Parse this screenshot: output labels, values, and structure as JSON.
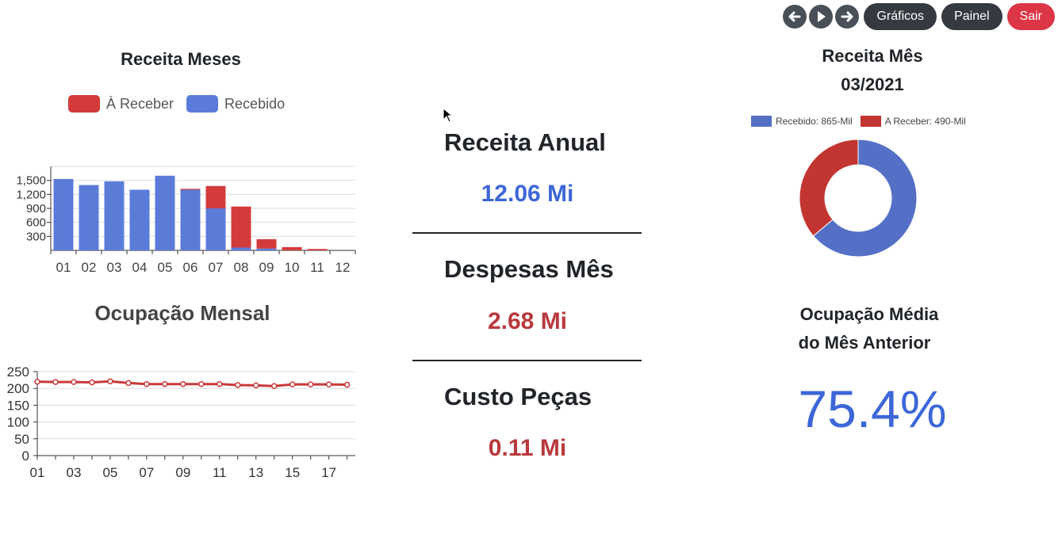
{
  "nav": {
    "graficos_label": "Gráficos",
    "painel_label": "Painel",
    "sair_label": "Sair",
    "prev_icon": "arrow-left-icon",
    "play_icon": "play-icon",
    "next_icon": "arrow-right-icon"
  },
  "kpis": {
    "receita_anual": {
      "title": "Receita Anual",
      "value": "12.06 Mi"
    },
    "despesas_mes": {
      "title": "Despesas Mês",
      "value": "2.68 Mi"
    },
    "custo_pecas": {
      "title": "Custo Peças",
      "value": "0.11 Mi"
    }
  },
  "ocupacao_media": {
    "title_line1": "Ocupação Média",
    "title_line2": "do Mês Anterior",
    "value": "75.4%"
  },
  "colors": {
    "blue": "#5b7bd9",
    "red": "#d33b3b",
    "pill_dark": "#343a40",
    "pill_red": "#dc3545",
    "value_blue": "#3d67d8",
    "value_red": "#b8393d"
  },
  "chart_data": [
    {
      "type": "bar",
      "stacked": true,
      "title": "Receita Meses",
      "categories": [
        "01",
        "02",
        "03",
        "04",
        "05",
        "06",
        "07",
        "08",
        "09",
        "10",
        "11",
        "12"
      ],
      "series": [
        {
          "name": "À Receber",
          "color": "#d33b3b",
          "values": [
            0,
            0,
            0,
            0,
            0,
            20,
            480,
            880,
            200,
            70,
            30,
            0
          ]
        },
        {
          "name": "Recebido",
          "color": "#5b7bd9",
          "values": [
            1530,
            1400,
            1480,
            1300,
            1600,
            1300,
            900,
            60,
            40,
            0,
            0,
            0
          ]
        }
      ],
      "yticks": [
        "300",
        "600",
        "900",
        "1,200",
        "1,500"
      ],
      "ylim": [
        0,
        1800
      ],
      "grid": true,
      "legend": "top"
    },
    {
      "type": "line",
      "title": "Ocupação Mensal",
      "x": [
        "01",
        "02",
        "03",
        "04",
        "05",
        "06",
        "07",
        "08",
        "09",
        "10",
        "11",
        "12",
        "13",
        "14",
        "15",
        "16",
        "17",
        "18"
      ],
      "xticks": [
        "01",
        "03",
        "05",
        "07",
        "09",
        "11",
        "13",
        "15",
        "17"
      ],
      "series": [
        {
          "color": "#c93a3a",
          "values": [
            220,
            219,
            219,
            218,
            221,
            216,
            213,
            213,
            213,
            213,
            213,
            210,
            209,
            207,
            212,
            212,
            212,
            211
          ]
        }
      ],
      "yticks": [
        "0",
        "50",
        "100",
        "150",
        "200",
        "250"
      ],
      "ylim": [
        0,
        250
      ],
      "grid": true
    },
    {
      "type": "pie",
      "donut": true,
      "title": "Receita Mês",
      "subtitle": "03/2021",
      "slices": [
        {
          "label": "Recebido: 865-Mil",
          "value": 865,
          "color": "#5470c6"
        },
        {
          "label": "A Receber: 490-Mil",
          "value": 490,
          "color": "#c23531"
        }
      ],
      "legend": "top"
    }
  ]
}
